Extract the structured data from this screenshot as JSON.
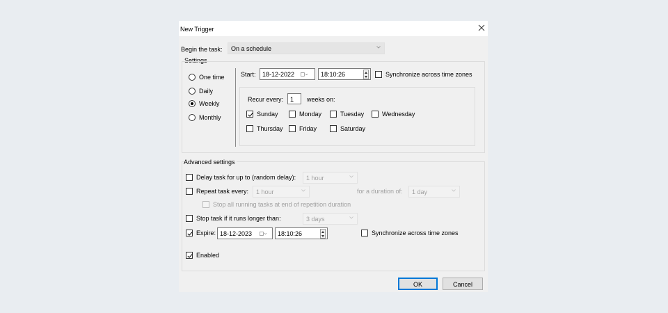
{
  "dialog": {
    "title": "New Trigger"
  },
  "begin": {
    "label": "Begin the task:",
    "value": "On a schedule"
  },
  "settings": {
    "group_label": "Settings",
    "schedule_options": [
      {
        "label": "One time",
        "selected": false
      },
      {
        "label": "Daily",
        "selected": false
      },
      {
        "label": "Weekly",
        "selected": true
      },
      {
        "label": "Monthly",
        "selected": false
      }
    ],
    "start_label": "Start:",
    "start_date": "18-12-2022",
    "start_time": "18:10:26",
    "sync_label": "Synchronize across time zones",
    "sync_checked": false,
    "recur_label": "Recur every:",
    "recur_value": "1",
    "weeks_on_label": "weeks on:",
    "days": [
      {
        "label": "Sunday",
        "checked": true
      },
      {
        "label": "Monday",
        "checked": false
      },
      {
        "label": "Tuesday",
        "checked": false
      },
      {
        "label": "Wednesday",
        "checked": false
      },
      {
        "label": "Thursday",
        "checked": false
      },
      {
        "label": "Friday",
        "checked": false
      },
      {
        "label": "Saturday",
        "checked": false
      }
    ]
  },
  "advanced": {
    "group_label": "Advanced settings",
    "delay": {
      "label": "Delay task for up to (random delay):",
      "value": "1 hour",
      "checked": false
    },
    "repeat": {
      "label": "Repeat task every:",
      "value": "1 hour",
      "checked": false,
      "duration_label": "for a duration of:",
      "duration_value": "1 day"
    },
    "stop_running": {
      "label": "Stop all running tasks at end of repetition duration",
      "checked": false
    },
    "stop_longer": {
      "label": "Stop task if it runs longer than:",
      "value": "3 days",
      "checked": false
    },
    "expire": {
      "label": "Expire:",
      "date": "18-12-2023",
      "time": "18:10:26",
      "checked": true
    },
    "expire_sync": {
      "label": "Synchronize across time zones",
      "checked": false
    },
    "enabled": {
      "label": "Enabled",
      "checked": true
    }
  },
  "buttons": {
    "ok": "OK",
    "cancel": "Cancel"
  },
  "colors": {
    "accent": "#0078d7",
    "page_bg": "#e9edf1",
    "dialog_bg": "#f0f0f0"
  }
}
